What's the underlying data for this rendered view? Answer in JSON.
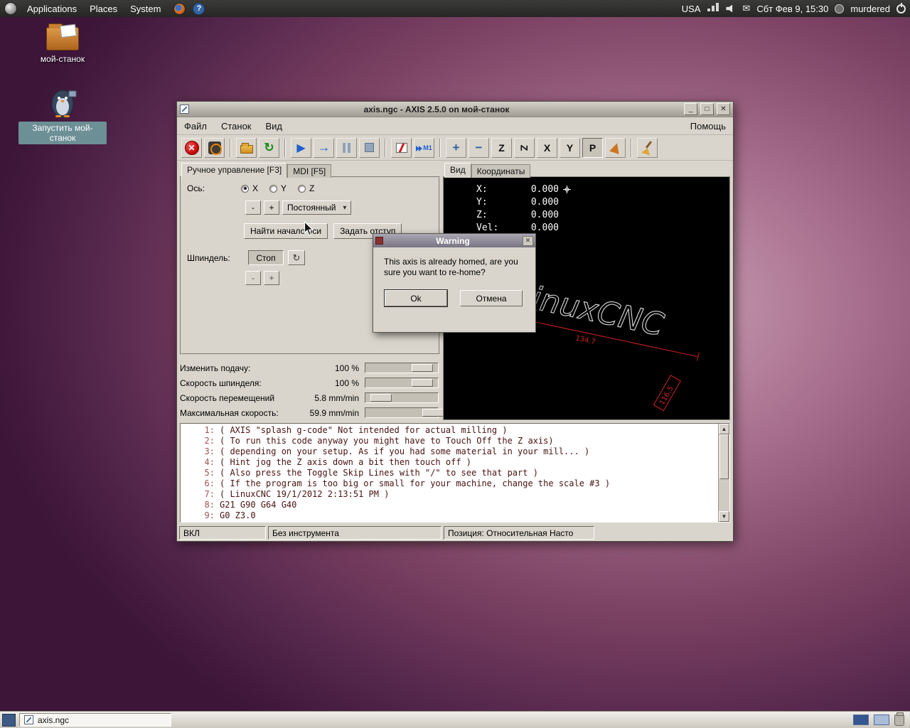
{
  "top_panel": {
    "menus": [
      {
        "label": "Applications"
      },
      {
        "label": "Places"
      },
      {
        "label": "System"
      }
    ],
    "keyboard_layout": "USA",
    "clock": "Сбт Фев 9, 15:30",
    "username": "murdered"
  },
  "desktop": {
    "icons": [
      {
        "label": "мой-станок"
      },
      {
        "label": "Запустить мой-станок"
      }
    ]
  },
  "taskbar": {
    "task": "axis.ngc"
  },
  "icons": {
    "minimize": "_",
    "maximize": "□",
    "close": "✕",
    "estop": "✕",
    "reload": "↻",
    "run": "▶",
    "step": "→",
    "m1": "M1",
    "zoom_in": "+",
    "zoom_out": "−",
    "view_z": "Z",
    "view_x": "X",
    "view_y": "Y",
    "view_p": "P",
    "chevron_down": "▾",
    "spindle_cw": "↻",
    "mail": "✉",
    "help": "?",
    "scroll_up": "▲",
    "scroll_down": "▼"
  },
  "axis_window": {
    "title": "axis.ngc - AXIS 2.5.0 on мой-станок",
    "menus": [
      {
        "label": "Файл"
      },
      {
        "label": "Станок"
      },
      {
        "label": "Вид"
      }
    ],
    "help_menu": "Помощь",
    "left_panel": {
      "tabs": [
        {
          "label": "Ручное управление [F3]"
        },
        {
          "label": "MDI [F5]"
        }
      ],
      "axis_label": "Ось:",
      "axes": [
        {
          "label": "X"
        },
        {
          "label": "Y"
        },
        {
          "label": "Z"
        }
      ],
      "jog_minus": "-",
      "jog_plus": "+",
      "jog_mode": "Постоянный",
      "home_button": "Найти начало оси",
      "touchoff_button": "Задать отступ",
      "spindle_label": "Шпиндель:",
      "spindle_stop_button": "Стоп",
      "spindle_minus": "-",
      "spindle_plus": "+",
      "overrides": [
        {
          "label": "Изменить подачу:",
          "value": "100 %"
        },
        {
          "label": "Скорость шпинделя:",
          "value": "100 %"
        },
        {
          "label": "Скорость перемещений",
          "value": "5.8 mm/min"
        },
        {
          "label": "Максимальная скорость:",
          "value": "59.9 mm/min"
        }
      ]
    },
    "right_panel": {
      "tabs": [
        {
          "label": "Вид"
        },
        {
          "label": "Координаты"
        }
      ],
      "dro": [
        {
          "label": "X:",
          "value": "0.000"
        },
        {
          "label": "Y:",
          "value": "0.000"
        },
        {
          "label": "Z:",
          "value": "0.000"
        },
        {
          "label": "Vel:",
          "value": "0.000"
        }
      ],
      "preview": {
        "logo_text": "LinuxCNC",
        "dim_x": "134.7",
        "dim_y": "116.5"
      }
    },
    "gcode": {
      "lines": [
        {
          "num": "1:",
          "text": "( AXIS \"splash g-code\" Not intended for actual milling )"
        },
        {
          "num": "2:",
          "text": "( To run this code anyway you might have to Touch Off the Z axis)"
        },
        {
          "num": "3:",
          "text": "( depending on your setup. As if you had some material in your mill... )"
        },
        {
          "num": "4:",
          "text": "( Hint jog the Z axis down a bit then touch off )"
        },
        {
          "num": "5:",
          "text": "( Also press the Toggle Skip Lines with \"/\" to see that part )"
        },
        {
          "num": "6:",
          "text": "( If the program is too big or small for your machine, change the scale #3 )"
        },
        {
          "num": "7:",
          "text": "( LinuxCNC 19/1/2012 2:13:51 PM )"
        },
        {
          "num": "8:",
          "text": "G21 G90 G64 G40"
        },
        {
          "num": "9:",
          "text": "G0 Z3.0"
        }
      ]
    },
    "statusbar": [
      {
        "text": "ВКЛ"
      },
      {
        "text": "Без инструмента"
      },
      {
        "text": "Позиция: Относительная Насто"
      }
    ]
  },
  "dialog": {
    "title": "Warning",
    "message": "This axis is already homed, are you sure you want to re-home?",
    "ok_button": "Ok",
    "cancel_button": "Отмена"
  }
}
